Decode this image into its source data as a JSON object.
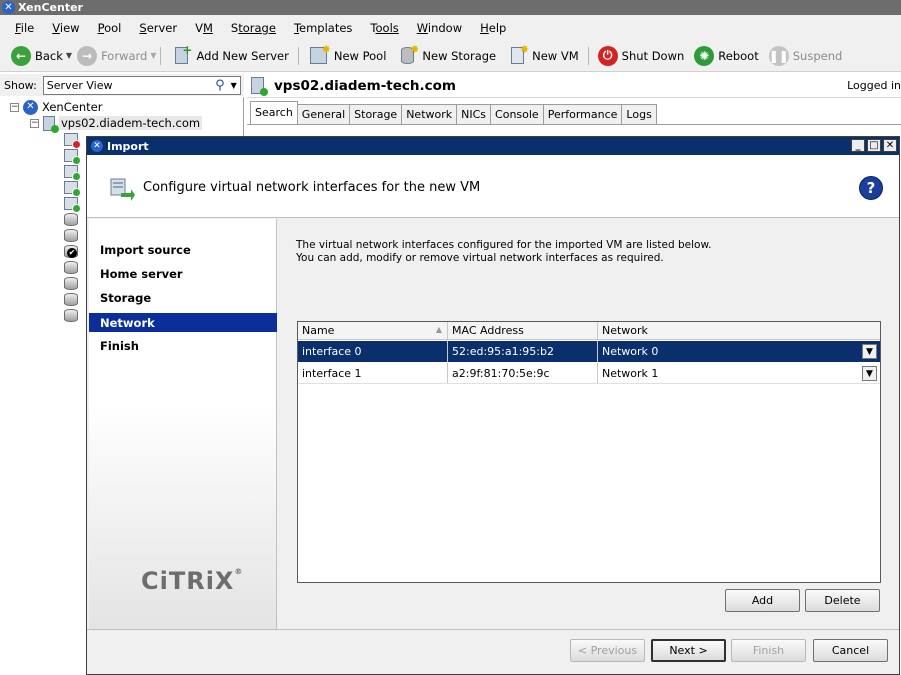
{
  "app": {
    "title": "XenCenter"
  },
  "menu": [
    {
      "label": "File",
      "hot": "F",
      "rest": "ile"
    },
    {
      "label": "View",
      "hot": "V",
      "rest": "iew"
    },
    {
      "label": "Pool",
      "hot": "P",
      "rest": "ool"
    },
    {
      "label": "Server",
      "hot": "S",
      "rest": "erver"
    },
    {
      "label": "VM",
      "hot": "V",
      "rest": "M"
    },
    {
      "label": "Storage",
      "hot": "S",
      "rest": "torage"
    },
    {
      "label": "Templates",
      "hot": "T",
      "rest": "emplates"
    },
    {
      "label": "Tools",
      "hot": "T",
      "rest": "ools"
    },
    {
      "label": "Window",
      "hot": "W",
      "rest": "indow"
    },
    {
      "label": "Help",
      "hot": "H",
      "rest": "elp"
    }
  ],
  "toolbar": {
    "back": "Back",
    "forward": "Forward",
    "add_server": "Add New Server",
    "new_pool": "New Pool",
    "new_storage": "New Storage",
    "new_vm": "New VM",
    "shut_down": "Shut Down",
    "reboot": "Reboot",
    "suspend": "Suspend"
  },
  "show": {
    "label": "Show:",
    "value": "Server View"
  },
  "tree": {
    "root": "XenCenter",
    "host": "vps02.diadem-tech.com"
  },
  "right": {
    "host_title": "vps02.diadem-tech.com",
    "logged_in": "Logged in",
    "tabs": [
      "Search",
      "General",
      "Storage",
      "Network",
      "NICs",
      "Console",
      "Performance",
      "Logs"
    ]
  },
  "dialog": {
    "title": "Import",
    "header_title": "Configure virtual network interfaces for the new VM",
    "help": "?",
    "steps": [
      "Import source",
      "Home server",
      "Storage",
      "Network",
      "Finish"
    ],
    "active_step": "Network",
    "brand": "CiTRiX",
    "desc_line1": "The virtual network interfaces configured for the imported VM are listed below.",
    "desc_line2": "You can add, modify or remove virtual network interfaces as required.",
    "grid": {
      "columns": [
        "Name",
        "MAC Address",
        "Network"
      ],
      "rows": [
        {
          "name": "interface 0",
          "mac": "52:ed:95:a1:95:b2",
          "network": "Network 0"
        },
        {
          "name": "interface 1",
          "mac": "a2:9f:81:70:5e:9c",
          "network": "Network 1"
        }
      ]
    },
    "buttons": {
      "add": "Add",
      "delete": "Delete",
      "previous": "< Previous",
      "next": "Next >",
      "finish": "Finish",
      "cancel": "Cancel"
    }
  }
}
